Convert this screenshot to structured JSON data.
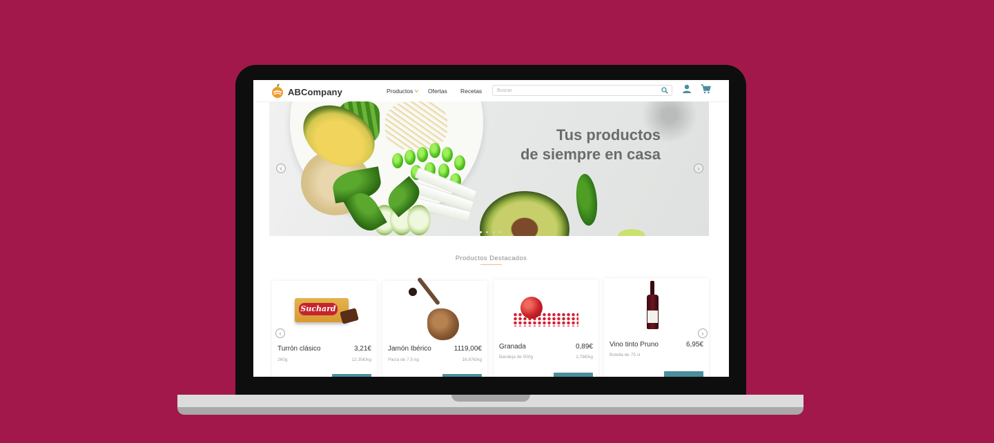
{
  "header": {
    "brand": "ABCompany",
    "nav": [
      {
        "label": "Productos"
      },
      {
        "label": "Ofertas"
      },
      {
        "label": "Recetas"
      }
    ],
    "search": {
      "placeholder": "Buscar"
    }
  },
  "hero": {
    "title_line1": "Tus productos",
    "title_line2": "de siempre en casa",
    "slides_count": 4,
    "active_slide": 1
  },
  "featured": {
    "title": "Productos Destacados",
    "products": [
      {
        "name": "Turrón clásico",
        "price": "3,21€",
        "quantity": "260g",
        "unit_price": "12,35€/kg",
        "brand_on_pack": "Suchard"
      },
      {
        "name": "Jamón Ibérico",
        "price": "1119,00€",
        "quantity": "Pieza de 7,5 kg",
        "unit_price": "16,87€/kg"
      },
      {
        "name": "Granada",
        "price": "0,89€",
        "quantity": "Bandeja de 500g",
        "unit_price": "1,78€/kg"
      },
      {
        "name": "Vino tinto Pruno",
        "price": "6,95€",
        "quantity": "Botella de 75 cl"
      }
    ]
  },
  "colors": {
    "background": "#a3184b",
    "accent_orange": "#e8912e",
    "button_teal": "#4a8f9c",
    "icon_teal": "#4a8f9c"
  },
  "icons": {
    "logo": "orange-fruit-logo",
    "search": "search-icon",
    "user": "user-icon",
    "cart": "shopping-cart-icon",
    "dropdown": "chevron-down-icon",
    "prev": "chevron-left-icon",
    "next": "chevron-right-icon"
  }
}
